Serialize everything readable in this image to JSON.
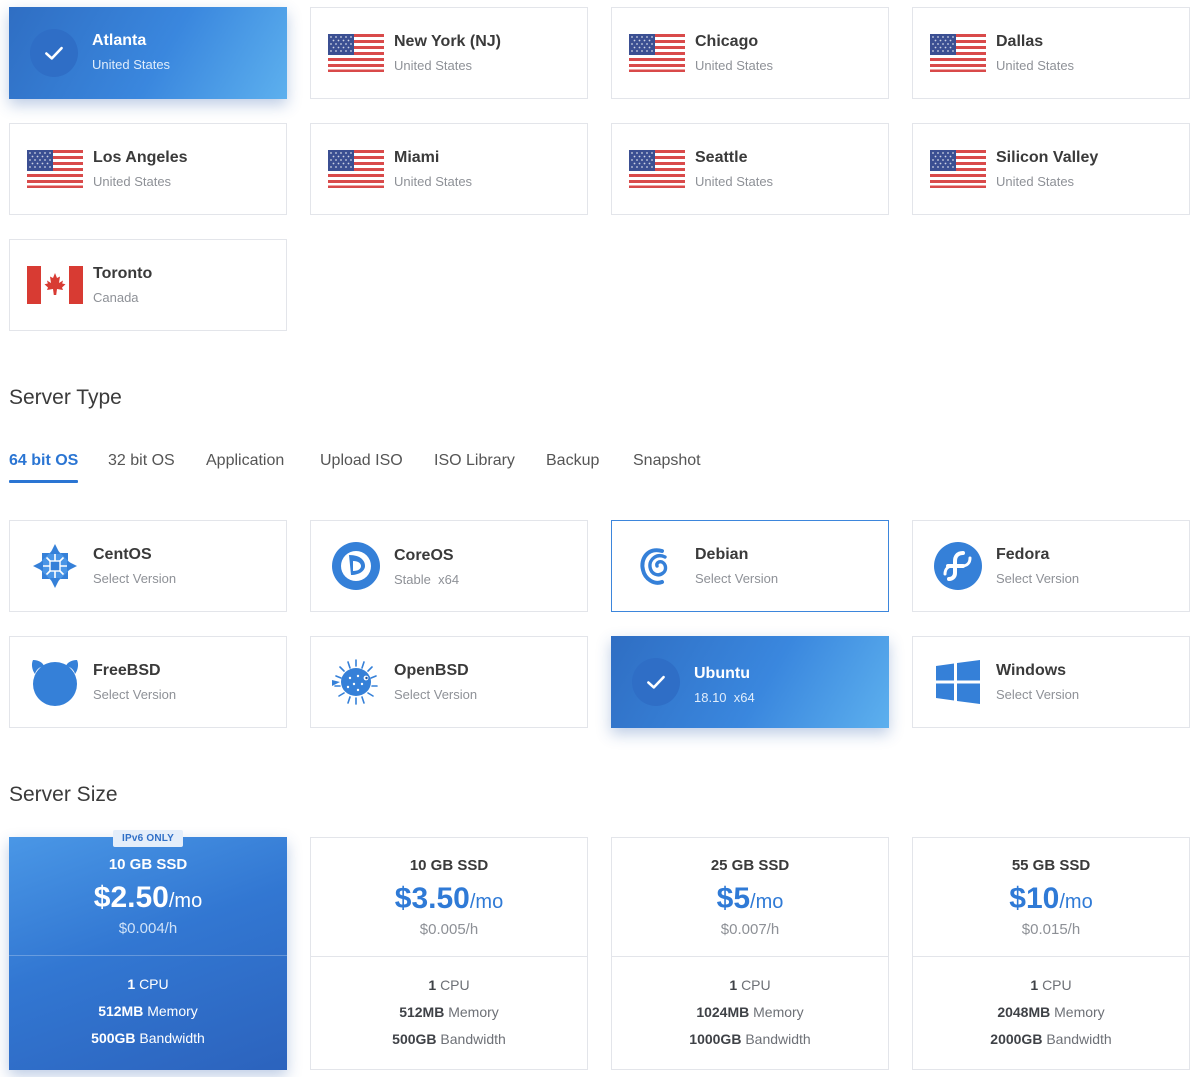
{
  "locations": [
    {
      "city": "Atlanta",
      "country": "United States",
      "flag": "us-flag",
      "selected": true
    },
    {
      "city": "New York (NJ)",
      "country": "United States",
      "flag": "us-flag",
      "selected": false
    },
    {
      "city": "Chicago",
      "country": "United States",
      "flag": "us-flag",
      "selected": false
    },
    {
      "city": "Dallas",
      "country": "United States",
      "flag": "us-flag",
      "selected": false
    },
    {
      "city": "Los Angeles",
      "country": "United States",
      "flag": "us-flag",
      "selected": false
    },
    {
      "city": "Miami",
      "country": "United States",
      "flag": "us-flag",
      "selected": false
    },
    {
      "city": "Seattle",
      "country": "United States",
      "flag": "us-flag",
      "selected": false
    },
    {
      "city": "Silicon Valley",
      "country": "United States",
      "flag": "us-flag",
      "selected": false
    },
    {
      "city": "Toronto",
      "country": "Canada",
      "flag": "canada-flag",
      "selected": false
    }
  ],
  "server_type": {
    "title": "Server Type",
    "tabs": [
      "64 bit OS",
      "32 bit OS",
      "Application",
      "Upload ISO",
      "ISO Library",
      "Backup",
      "Snapshot"
    ],
    "active_tab": "64 bit OS",
    "os": [
      {
        "name": "CentOS",
        "sub": "Select Version",
        "icon": "centos-icon"
      },
      {
        "name": "CoreOS",
        "sub": "Stable  x64",
        "icon": "coreos-icon"
      },
      {
        "name": "Debian",
        "sub": "Select Version",
        "icon": "debian-icon"
      },
      {
        "name": "Fedora",
        "sub": "Select Version",
        "icon": "fedora-icon"
      },
      {
        "name": "FreeBSD",
        "sub": "Select Version",
        "icon": "freebsd-icon"
      },
      {
        "name": "OpenBSD",
        "sub": "Select Version",
        "icon": "openbsd-icon"
      },
      {
        "name": "Ubuntu",
        "sub": "18.10  x64",
        "icon": "check-icon"
      },
      {
        "name": "Windows",
        "sub": "Select Version",
        "icon": "windows-icon"
      }
    ]
  },
  "server_size": {
    "title": "Server Size",
    "plans": [
      {
        "badge": "IPv6 ONLY",
        "ssd": "10 GB SSD",
        "price": "$2.50",
        "unit": "/mo",
        "hourly": "$0.004/h",
        "cpu_num": "1",
        "cpu_label": "CPU",
        "mem_num": "512MB",
        "mem_label": "Memory",
        "bw_num": "500GB",
        "bw_label": "Bandwidth"
      },
      {
        "ssd": "10 GB SSD",
        "price": "$3.50",
        "unit": "/mo",
        "hourly": "$0.005/h",
        "cpu_num": "1",
        "cpu_label": "CPU",
        "mem_num": "512MB",
        "mem_label": "Memory",
        "bw_num": "500GB",
        "bw_label": "Bandwidth"
      },
      {
        "ssd": "25 GB SSD",
        "price": "$5",
        "unit": "/mo",
        "hourly": "$0.007/h",
        "cpu_num": "1",
        "cpu_label": "CPU",
        "mem_num": "1024MB",
        "mem_label": "Memory",
        "bw_num": "1000GB",
        "bw_label": "Bandwidth"
      },
      {
        "ssd": "55 GB SSD",
        "price": "$10",
        "unit": "/mo",
        "hourly": "$0.015/h",
        "cpu_num": "1",
        "cpu_label": "CPU",
        "mem_num": "2048MB",
        "mem_label": "Memory",
        "bw_num": "2000GB",
        "bw_label": "Bandwidth"
      }
    ]
  },
  "colors": {
    "accent": "#2f7ad6",
    "selected_gradient_start": "#2f6ec3",
    "selected_gradient_end": "#5db0ee",
    "us_red": "#d94a4a",
    "us_blue": "#3b4f92",
    "canada_red": "#d83b33",
    "os_icon_blue": "#3580d8"
  }
}
